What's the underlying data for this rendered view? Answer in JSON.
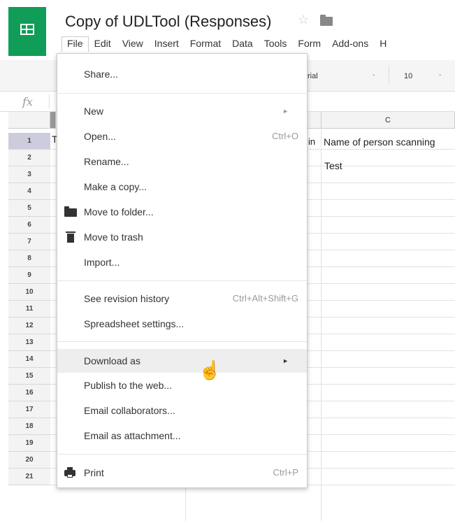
{
  "doc": {
    "title": "Copy of UDLTool (Responses)"
  },
  "menubar": [
    "File",
    "Edit",
    "View",
    "Insert",
    "Format",
    "Data",
    "Tools",
    "Form",
    "Add-ons",
    "H"
  ],
  "toolbar": {
    "font": "rial",
    "font_size": "10",
    "arrow": "-"
  },
  "formula": {
    "fx": "fx"
  },
  "columns": {
    "c": "C"
  },
  "rows": [
    "1",
    "2",
    "3",
    "4",
    "5",
    "6",
    "7",
    "8",
    "9",
    "10",
    "11",
    "12",
    "13",
    "14",
    "15",
    "16",
    "17",
    "18",
    "19",
    "20",
    "21"
  ],
  "cells": {
    "a1_partial": "T",
    "b1_partial": "in",
    "c1": "Name of person scanning",
    "c2": "Test"
  },
  "file_menu": {
    "share": "Share...",
    "new": "New",
    "open": "Open...",
    "open_sc": "Ctrl+O",
    "rename": "Rename...",
    "copy": "Make a copy...",
    "move_folder": "Move to folder...",
    "move_trash": "Move to trash",
    "import": "Import...",
    "revision": "See revision history",
    "revision_sc": "Ctrl+Alt+Shift+G",
    "settings": "Spreadsheet settings...",
    "download": "Download as",
    "publish": "Publish to the web...",
    "email_collab": "Email collaborators...",
    "email_attach": "Email as attachment...",
    "print": "Print",
    "print_sc": "Ctrl+P",
    "arrow": "►"
  },
  "icons": {
    "star": "star-icon",
    "folder": "folder-icon",
    "cursor": "hand-pointer-icon"
  }
}
